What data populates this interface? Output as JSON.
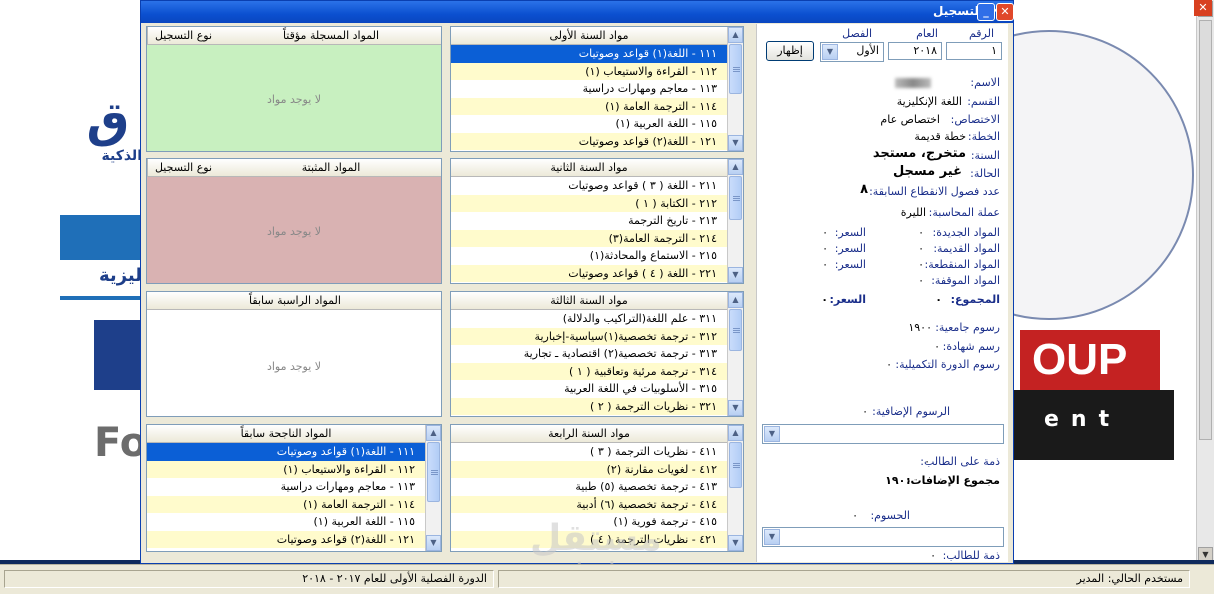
{
  "window": {
    "title": "التسجيل"
  },
  "filters": {
    "number_label": "الرقم",
    "number_value": "١",
    "year_label": "العام",
    "year_value": "٢٠١٨",
    "term_label": "الفصل",
    "term_value": "الأول",
    "show_button": "إظهار"
  },
  "student": {
    "name_label": "الاسم:",
    "dept_label": "القسم:",
    "dept_value": "اللغة الإنكليزية",
    "spec_label": "الاختصاص:",
    "spec_value": "اختصاص عام",
    "plan_label": "الخطة:",
    "plan_value": "خطة قديمة",
    "year_label": "السنة:",
    "year_value": "متخرج، مستجد",
    "status_label": "الحالة:",
    "status_value": "غير مسجل",
    "prev_terms_label": "عدد فصول الانقطاع السابقة:",
    "prev_terms_value": "٨",
    "currency_label": "عملة المحاسبة:",
    "currency_value": "الليرة"
  },
  "fees": {
    "new_label": "المواد الجديدة:",
    "new_count": "٠",
    "new_price_label": "السعر:",
    "new_price": "٠",
    "old_label": "المواد القديمة:",
    "old_count": "٠",
    "old_price_label": "السعر:",
    "old_price": "٠",
    "cut_label": "المواد المنقطعة:",
    "cut_count": "٠",
    "cut_price_label": "السعر:",
    "cut_price": "٠",
    "held_label": "المواد الموقفة:",
    "held_count": "٠",
    "total_label": "المجموع:",
    "total_count": "٠",
    "total_price_label": "السعر:",
    "total_price": "٠",
    "university_label": "رسوم جامعية:",
    "university_value": "١٩٠٠",
    "cert_label": "رسم شهادة:",
    "cert_value": "٠",
    "complement_label": "رسوم الدورة التكميلية:",
    "complement_value": "٠",
    "extra_label": "الرسوم الإضافية:",
    "extra_value": "٠",
    "on_student_label": "ذمة على الطالب:",
    "on_student_value": "٠",
    "additions_total_label": "مجموع الإضافات:",
    "additions_total_value": "١٩٠٠",
    "discounts_label": "الحسوم:",
    "discounts_value": "٠",
    "for_student_label": "ذمة للطالب:",
    "for_student_value": "٠"
  },
  "panels": {
    "temp_registered": {
      "col_subjects": "المواد المسجلة مؤقتاً",
      "col_type": "نوع التسجيل",
      "empty": "لا يوجد مواد"
    },
    "frozen": {
      "col_subjects": "المواد المثبتة",
      "col_type": "نوع التسجيل",
      "empty": "لا يوجد مواد"
    },
    "prev_failed": {
      "header": "المواد الراسبة سابقاً",
      "empty": "لا يوجد مواد"
    },
    "prev_passed": {
      "header": "المواد الناجحة سابقاً",
      "rows": [
        "١١١ - اللغة(١) قواعد وصوتيات",
        "١١٢ - القراءة والاستيعاب (١)",
        "١١٣ - معاجم ومهارات دراسية",
        "١١٤ - الترجمة العامة (١)",
        "١١٥ - اللغة العربية (١)",
        "١٢١ - اللغة(٢) قواعد وصوتيات"
      ]
    },
    "year1": {
      "header": "مواد السنة الأولى",
      "rows": [
        "١١١ - اللغة(١) قواعد وصوتيات",
        "١١٢ - القراءة والاستيعاب (١)",
        "١١٣ - معاجم ومهارات دراسية",
        "١١٤ - الترجمة العامة (١)",
        "١١٥ - اللغة العربية (١)",
        "١٢١ - اللغة(٢) قواعد وصوتيات"
      ]
    },
    "year2": {
      "header": "مواد السنة الثانية",
      "rows": [
        "٢١١ - اللغة ( ٣ ) قواعد وصوتيات",
        "٢١٢ - الكتابة ( ١ )",
        "٢١٣ - تاريخ الترجمة",
        "٢١٤ - الترجمة العامة(٣)",
        "٢١٥ - الاستماع والمحادثة(١)",
        "٢٢١ - اللغة ( ٤ ) قواعد وصوتيات"
      ]
    },
    "year3": {
      "header": "مواد السنة الثالثة",
      "rows": [
        "٣١١ - علم اللغة(التراكيب والدلالة)",
        "٣١٢ - ترجمة تخصصية(١)سياسية-إخبارية",
        "٣١٣ - ترجمة تخصصية(٢) اقتصادية ـ تجارية",
        "٣١٤ - ترجمة مرئية وتعاقبية ( ١ )",
        "٣١٥ - الأسلوبيات في اللغة العربية",
        "٣٢١ - نظريات الترجمة ( ٢ )"
      ]
    },
    "year4": {
      "header": "مواد السنة الرابعة",
      "rows": [
        "٤١١ - نظريات الترجمة ( ٣ )",
        "٤١٢ - لغويات مقارنة (٢)",
        "٤١٣ - ترجمة تخصصية (٥) طبية",
        "٤١٤ - ترجمة تخصصية (٦) أدبية",
        "٤١٥ - ترجمة فورية (١)",
        "٤٢١ - نظريات الترجمة ( ٤ )"
      ]
    }
  },
  "status": {
    "term_info": "الدورة الفصلية الأولى للعام ٢٠١٧ - ٢٠١٨",
    "current_user": "مستخدم الحالي: المدير"
  },
  "background": {
    "left_logo_text": "الذكية",
    "left_red_text": "ليزية",
    "right_logo": "OUP",
    "right_word": "ent",
    "left_letters": "Fo"
  },
  "watermark": {
    "arabic": "مستقل",
    "latin": "mostaql.com"
  },
  "colors": {
    "temp_panel": "#c8f0c0",
    "frozen_panel": "#d9b2b2",
    "selection": "#0b5fd6",
    "row_alt": "#fffbcc",
    "title_bar": "#0b50d0"
  }
}
